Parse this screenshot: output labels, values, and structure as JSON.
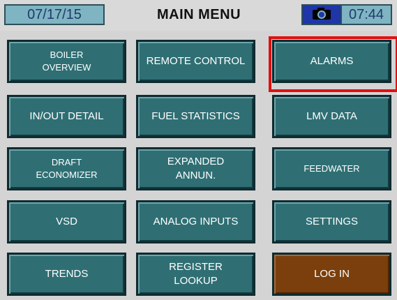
{
  "header": {
    "date": "07/17/15",
    "title": "MAIN MENU",
    "time": "07:44",
    "camera_icon": "camera-icon"
  },
  "menu": [
    [
      "BOILER\nOVERVIEW",
      "REMOTE CONTROL",
      "ALARMS"
    ],
    [
      "IN/OUT DETAIL",
      "FUEL STATISTICS",
      "LMV DATA"
    ],
    [
      "DRAFT\nECONOMIZER",
      "EXPANDED\nANNUN.",
      "FEEDWATER"
    ],
    [
      "VSD",
      "ANALOG INPUTS",
      "SETTINGS"
    ],
    [
      "TRENDS",
      "REGISTER\nLOOKUP",
      "LOG IN"
    ]
  ],
  "highlight_color": "#e01010",
  "login_color": "#7a3f0c",
  "button_color": "#2f6f74"
}
